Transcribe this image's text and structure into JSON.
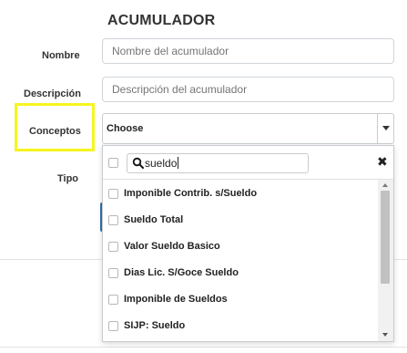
{
  "form": {
    "title": "ACUMULADOR",
    "nombre_label": "Nombre",
    "nombre_placeholder": "Nombre del acumulador",
    "descripcion_label": "Descripción",
    "descripcion_placeholder": "Descripción del acumulador",
    "conceptos_label": "Conceptos",
    "conceptos_value": "Choose",
    "tipo_label": "Tipo"
  },
  "dropdown": {
    "search_value": "sueldo",
    "close_icon": "close-icon",
    "options": [
      {
        "label": "Imponible Contrib. s/Sueldo",
        "checked": false
      },
      {
        "label": "Sueldo Total",
        "checked": false
      },
      {
        "label": "Valor Sueldo Basico",
        "checked": false
      },
      {
        "label": "Dias Lic. S/Goce Sueldo",
        "checked": false
      },
      {
        "label": "Imponible de Sueldos",
        "checked": false
      },
      {
        "label": "SIJP: Sueldo",
        "checked": false
      }
    ]
  },
  "colors": {
    "highlight": "#f7f51e",
    "accent": "#2f6fb0"
  }
}
